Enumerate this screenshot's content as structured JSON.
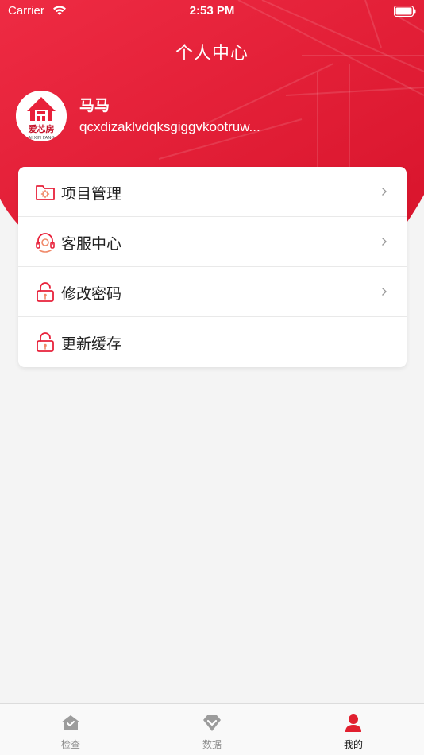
{
  "status_bar": {
    "carrier": "Carrier",
    "time": "2:53 PM"
  },
  "header": {
    "title": "个人中心"
  },
  "profile": {
    "name": "马马",
    "user_id": "qcxdizaklvdqksgiggvkootruw...",
    "avatar_logo_text": "爱芯房",
    "avatar_logo_subtext": "AI XIN FANG"
  },
  "menu": {
    "items": [
      {
        "label": "项目管理",
        "icon": "folder-gear-icon",
        "has_chevron": true
      },
      {
        "label": "客服中心",
        "icon": "headset-icon",
        "has_chevron": true
      },
      {
        "label": "修改密码",
        "icon": "lock-icon",
        "has_chevron": true
      },
      {
        "label": "更新缓存",
        "icon": "lock-icon",
        "has_chevron": false
      }
    ]
  },
  "tab_bar": {
    "tabs": [
      {
        "label": "检查",
        "icon": "home-check-icon",
        "active": false
      },
      {
        "label": "数据",
        "icon": "diamond-chevron-icon",
        "active": false
      },
      {
        "label": "我的",
        "icon": "person-icon",
        "active": true
      }
    ]
  },
  "colors": {
    "primary": "#e8213a",
    "tab_inactive": "#8e8e8e",
    "tab_active": "#111111"
  }
}
